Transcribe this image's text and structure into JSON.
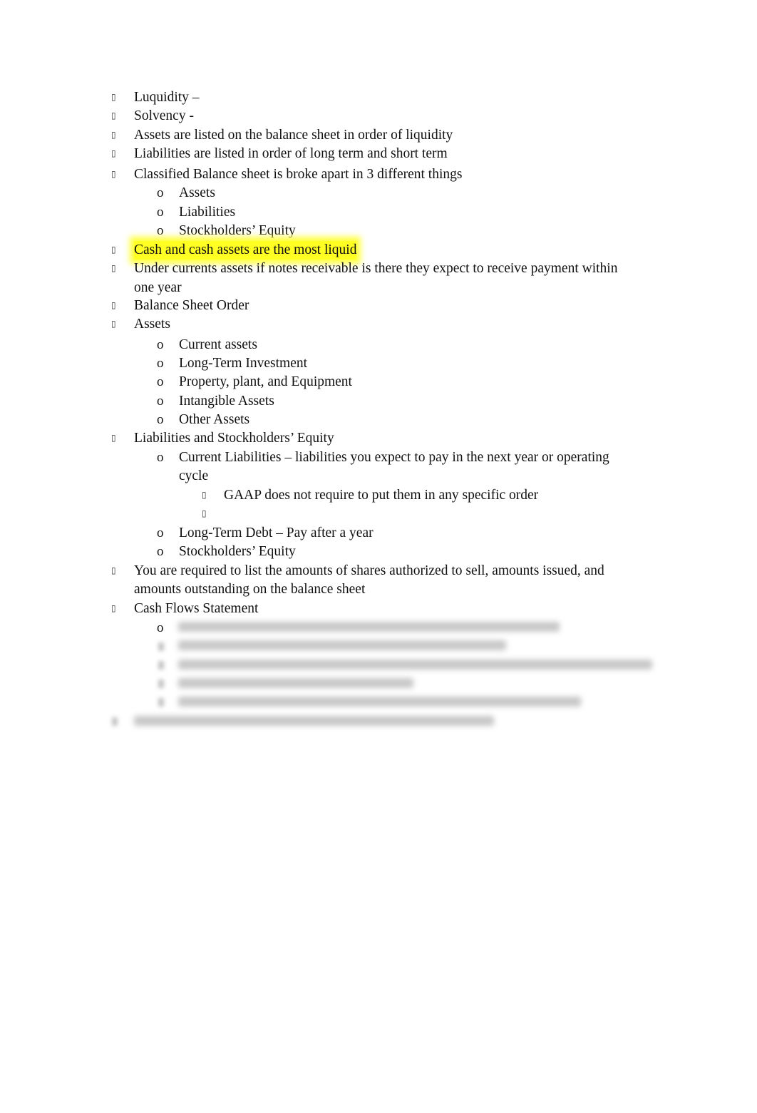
{
  "document": {
    "bullet_glyph": "▯",
    "sub_bullet_glyph": "o",
    "highlight_color": "#ffff24",
    "items": [
      {
        "text": "Luquidity –"
      },
      {
        "text": "Solvency -"
      },
      {
        "text": "Assets are listed on the balance sheet in order of liquidity"
      },
      {
        "text": "Liabilities are listed in order of long term and short term"
      },
      {
        "text": "Classified Balance sheet is broke apart in 3 different things"
      },
      {
        "text": "Assets"
      },
      {
        "text": "Liabilities"
      },
      {
        "text": "Stockholders’ Equity"
      },
      {
        "text": "Cash and cash assets are the most liquid"
      },
      {
        "text": "Under currents assets if notes receivable is there they expect to receive payment within"
      },
      {
        "text": "one year"
      },
      {
        "text": "Balance Sheet Order"
      },
      {
        "text": "Assets"
      },
      {
        "text": "Current assets"
      },
      {
        "text": "Long-Term Investment"
      },
      {
        "text": "Property, plant, and Equipment"
      },
      {
        "text": "Intangible Assets"
      },
      {
        "text": "Other Assets"
      },
      {
        "text": "Liabilities and Stockholders’ Equity"
      },
      {
        "text": "Current Liabilities – liabilities you expect to pay in the next year or operating"
      },
      {
        "text": "cycle"
      },
      {
        "text": "GAAP does not require to put them in any specific order"
      },
      {
        "text": ""
      },
      {
        "text": "Long-Term Debt – Pay after a year"
      },
      {
        "text": "Stockholders’ Equity"
      },
      {
        "text": "You are required to list the amounts of shares authorized to sell, amounts issued, and"
      },
      {
        "text": "amounts outstanding on the balance sheet"
      },
      {
        "text": "Cash Flows Statement"
      }
    ],
    "blurred_note": "Remaining content is blurred (preview)"
  }
}
